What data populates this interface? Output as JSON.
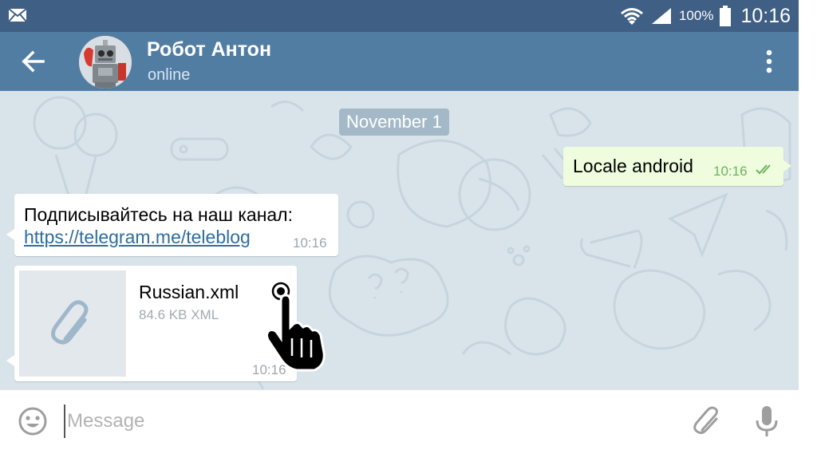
{
  "status_bar": {
    "battery_percent": "100%",
    "time": "10:16",
    "icons": [
      "mail-icon",
      "wifi-icon",
      "signal-icon",
      "battery-icon"
    ]
  },
  "toolbar": {
    "title": "Робот Антон",
    "status": "online",
    "icons": [
      "back-arrow-icon",
      "more-vert-icon"
    ]
  },
  "chat": {
    "date_divider": "November 1",
    "messages": [
      {
        "direction": "out",
        "text": "Locale android",
        "time": "10:16",
        "status": "read"
      },
      {
        "direction": "in",
        "text": "Подписывайтесь на наш канал:",
        "link": "https://telegram.me/teleblog",
        "time": "10:16"
      },
      {
        "direction": "in",
        "type": "file",
        "file_name": "Russian.xml",
        "file_meta": "84.6 KB XML",
        "time": "10:16"
      }
    ]
  },
  "composer": {
    "placeholder": "Message",
    "icons": [
      "emoji-icon",
      "attach-icon",
      "mic-icon"
    ]
  },
  "colors": {
    "status_bar": "#3f5f85",
    "toolbar": "#527da3",
    "chat_bg": "#d9e4ea",
    "outgoing_bubble": "#effdde",
    "link": "#2d6d9e"
  }
}
